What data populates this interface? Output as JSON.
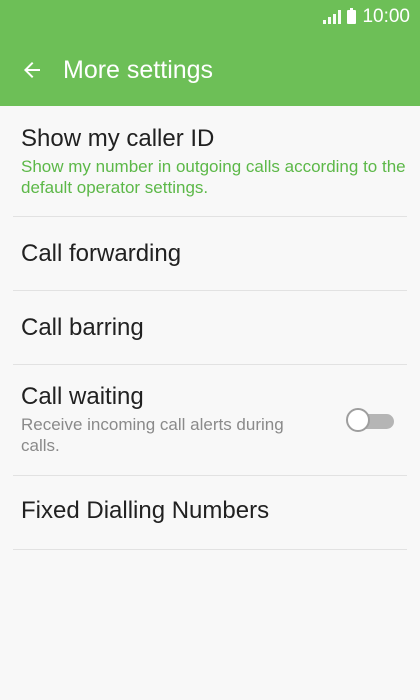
{
  "status_bar": {
    "time": "10:00"
  },
  "toolbar": {
    "title": "More settings"
  },
  "items": [
    {
      "title": "Show my caller ID",
      "subtitle": "Show my number in outgoing calls according to the default operator settings."
    },
    {
      "title": "Call forwarding"
    },
    {
      "title": "Call barring"
    },
    {
      "title": "Call waiting",
      "subtitle": "Receive incoming call alerts during calls.",
      "toggle_on": false
    },
    {
      "title": "Fixed Dialling Numbers"
    }
  ],
  "colors": {
    "app_bar": "#6dbf57",
    "subtitle_accent": "#5cb848",
    "subtitle_secondary": "#8a8a8a",
    "background": "#f8f8f8"
  },
  "icons": {
    "back": "arrow-left-icon",
    "signal": "signal-icon",
    "battery": "battery-icon"
  }
}
